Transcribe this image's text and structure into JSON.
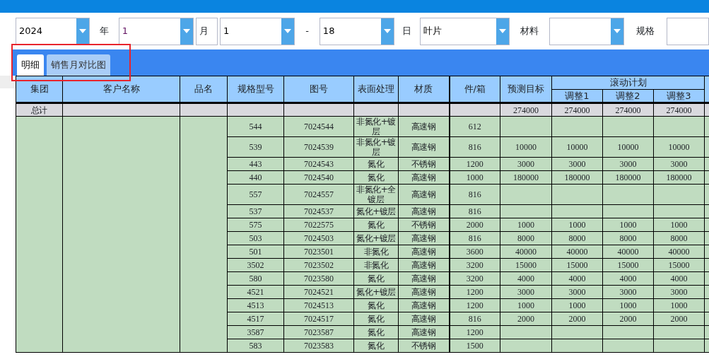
{
  "filters": [
    {
      "kind": "select",
      "value": "2024"
    },
    {
      "kind": "label",
      "text": "年"
    },
    {
      "kind": "select",
      "value": "1"
    },
    {
      "kind": "boxed_label",
      "text": "月"
    },
    {
      "kind": "select",
      "value": "1"
    },
    {
      "kind": "label",
      "text": "-"
    },
    {
      "kind": "select",
      "value": "18"
    },
    {
      "kind": "label",
      "text": "日"
    },
    {
      "kind": "select",
      "value": "叶片"
    },
    {
      "kind": "label",
      "text": "材料"
    },
    {
      "kind": "select"
    },
    {
      "kind": "label",
      "text": "规格"
    },
    {
      "kind": "input"
    }
  ],
  "tabs": [
    {
      "label": "明细",
      "selected": true
    },
    {
      "label": "销售月对比图",
      "selected": false
    }
  ],
  "table": {
    "columns": [
      "集团",
      "客户名称",
      "品名",
      "规格型号",
      "图号",
      "表面处理",
      "材质",
      "件/箱",
      "预测目标"
    ],
    "group_header": "滚动计划",
    "sub_columns": [
      "调整1",
      "调整2",
      "调整3"
    ],
    "total_row": {
      "label": "总计",
      "values": [
        "274000",
        "274000",
        "274000",
        "274000"
      ]
    },
    "rows": [
      {
        "spec": "544",
        "drawing": "7024544",
        "surface": "非氮化+镀层",
        "material": "高速钢",
        "per_box": "612"
      },
      {
        "spec": "539",
        "drawing": "7024539",
        "surface": "非氮化+镀层",
        "material": "高速钢",
        "per_box": "816",
        "plan": [
          "10000",
          "10000",
          "10000",
          "10000"
        ]
      },
      {
        "spec": "443",
        "drawing": "7024543",
        "surface": "氮化",
        "material": "不锈钢",
        "per_box": "1200",
        "plan": [
          "3000",
          "3000",
          "3000",
          "3000"
        ]
      },
      {
        "spec": "440",
        "drawing": "7024540",
        "surface": "氮化",
        "material": "高速钢",
        "per_box": "1000",
        "plan": [
          "180000",
          "180000",
          "180000",
          "180000"
        ]
      },
      {
        "spec": "557",
        "drawing": "7024557",
        "surface": "非氮化+全镀层",
        "material": "高速钢",
        "per_box": "816"
      },
      {
        "spec": "537",
        "drawing": "7024537",
        "surface": "氮化+镀层",
        "material": "高速钢",
        "per_box": "816"
      },
      {
        "spec": "575",
        "drawing": "7022575",
        "surface": "氮化",
        "material": "不锈钢",
        "per_box": "2000",
        "plan": [
          "1000",
          "1000",
          "1000",
          "1000"
        ]
      },
      {
        "spec": "503",
        "drawing": "7024503",
        "surface": "氮化+镀层",
        "material": "高速钢",
        "per_box": "816",
        "plan": [
          "8000",
          "8000",
          "8000",
          "8000"
        ]
      },
      {
        "spec": "501",
        "drawing": "7023501",
        "surface": "非氮化",
        "material": "高速钢",
        "per_box": "3600",
        "plan": [
          "40000",
          "40000",
          "40000",
          "40000"
        ]
      },
      {
        "spec": "3502",
        "drawing": "7023502",
        "surface": "非氮化",
        "material": "高速钢",
        "per_box": "3200",
        "plan": [
          "15000",
          "15000",
          "15000",
          "15000"
        ]
      },
      {
        "spec": "580",
        "drawing": "7023580",
        "surface": "氮化",
        "material": "高速钢",
        "per_box": "3200",
        "plan": [
          "4000",
          "4000",
          "4000",
          "4000"
        ]
      },
      {
        "spec": "4521",
        "drawing": "7024521",
        "surface": "氮化+镀层",
        "material": "高速钢",
        "per_box": "1200",
        "plan": [
          "3000",
          "3000",
          "3000",
          "3000"
        ]
      },
      {
        "spec": "4513",
        "drawing": "7024513",
        "surface": "氮化",
        "material": "高速钢",
        "per_box": "1200",
        "plan": [
          "1000",
          "1000",
          "1000",
          "1000"
        ]
      },
      {
        "spec": "4517",
        "drawing": "7024517",
        "surface": "氮化",
        "material": "高速钢",
        "per_box": "816",
        "plan": [
          "2000",
          "2000",
          "2000",
          "2000"
        ]
      },
      {
        "spec": "3587",
        "drawing": "7023587",
        "surface": "氮化",
        "material": "高速钢",
        "per_box": "1200"
      },
      {
        "spec": "583",
        "drawing": "7023583",
        "surface": "氮化",
        "material": "不锈钢",
        "per_box": "1500"
      }
    ]
  }
}
